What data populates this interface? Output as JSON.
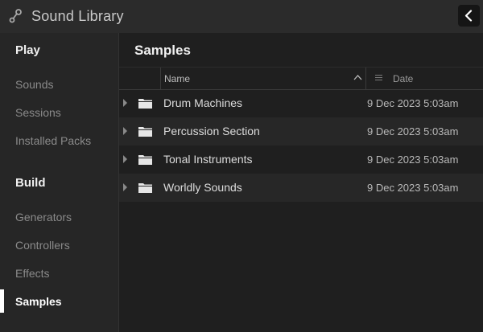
{
  "app": {
    "title": "Sound Library",
    "icon": "wrench-link-icon"
  },
  "header": {
    "back_icon": "chevron-left-icon"
  },
  "sidebar": {
    "play_heading": "Play",
    "play_items": [
      {
        "label": "Sounds"
      },
      {
        "label": "Sessions"
      },
      {
        "label": "Installed Packs"
      }
    ],
    "build_heading": "Build",
    "build_items": [
      {
        "label": "Generators"
      },
      {
        "label": "Controllers"
      },
      {
        "label": "Effects"
      },
      {
        "label": "Samples",
        "active": true
      }
    ]
  },
  "main": {
    "title": "Samples",
    "columns": {
      "name": "Name",
      "date": "Date"
    },
    "rows": [
      {
        "name": "Drum Machines",
        "date": "9 Dec 2023 5:03am"
      },
      {
        "name": "Percussion Section",
        "date": "9 Dec 2023 5:03am"
      },
      {
        "name": "Tonal Instruments",
        "date": "9 Dec 2023 5:03am"
      },
      {
        "name": "Worldly Sounds",
        "date": "9 Dec 2023 5:03am"
      }
    ]
  },
  "colors": {
    "background": "#1f1f1f",
    "sidebar": "#262626",
    "titlebar": "#2b2b2b",
    "active_indicator": "#ffffff"
  }
}
